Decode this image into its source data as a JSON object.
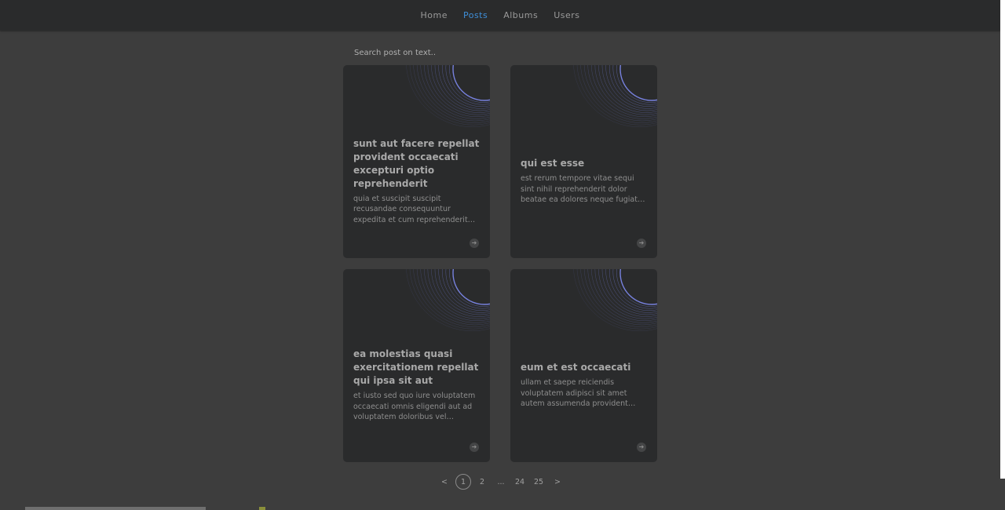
{
  "nav": {
    "items": [
      {
        "label": "Home"
      },
      {
        "label": "Posts"
      },
      {
        "label": "Albums"
      },
      {
        "label": "Users"
      }
    ],
    "active": "Posts"
  },
  "search": {
    "placeholder": "Search post on text.."
  },
  "posts": [
    {
      "title": "sunt aut facere repellat provident occaecati excepturi optio reprehenderit",
      "excerpt": "quia et suscipit suscipit recusandae consequuntur expedita et cum reprehenderit…"
    },
    {
      "title": "qui est esse",
      "excerpt": "est rerum tempore vitae sequi sint nihil reprehenderit dolor beatae ea dolores neque fugiat blanditiis…"
    },
    {
      "title": "ea molestias quasi exercitationem repellat qui ipsa sit aut",
      "excerpt": "et iusto sed quo iure voluptatem occaecati omnis eligendi aut ad voluptatem doloribus vel…"
    },
    {
      "title": "eum et est occaecati",
      "excerpt": "ullam et saepe reiciendis voluptatem adipisci sit amet autem assumenda provident…"
    }
  ],
  "card_arrow_icon": "arrow-right-icon",
  "pagination": {
    "prev": "<",
    "pages": [
      "1",
      "2",
      "...",
      "24",
      "25"
    ],
    "current": "1",
    "next": ">"
  },
  "colors": {
    "background": "#3d3d3d",
    "card": "#2a2b2c",
    "accent": "#3e8ed8",
    "ring": "#7b86e8"
  }
}
